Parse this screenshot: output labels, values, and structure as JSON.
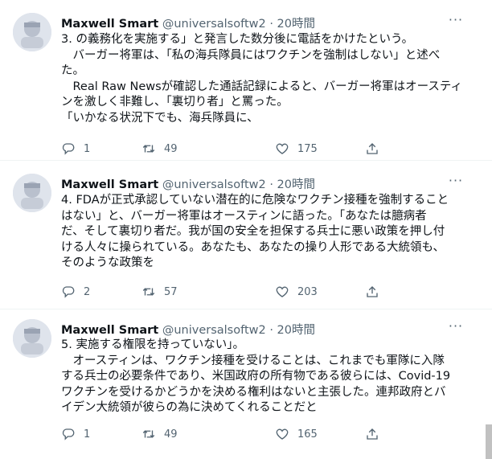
{
  "tweets": [
    {
      "name": "Maxwell Smart",
      "handle": "@universalsoftw2",
      "dot": "·",
      "time": "20時間",
      "lines": [
        "3. の義務化を実施する」と発言した数分後に電話をかけたという。",
        "　バーガー将軍は、「私の海兵隊員にはワクチンを強制はしない」と述べ",
        "た。",
        "　Real Raw Newsが確認した通話記録によると、バーガー将軍はオースティ",
        "ンを激しく非難し、「裏切り者」と罵った。",
        "「いかなる状況下でも、海兵隊員に、"
      ],
      "replies": "1",
      "retweets": "49",
      "likes": "175"
    },
    {
      "name": "Maxwell Smart",
      "handle": "@universalsoftw2",
      "dot": "·",
      "time": "20時間",
      "lines": [
        "4. FDAが正式承認していない潜在的に危険なワクチン接種を強制すること",
        "はない」と、バーガー将軍はオースティンに語った。「あなたは臆病者",
        "だ、そして裏切り者だ。我が国の安全を担保する兵士に悪い政策を押し付",
        "ける人々に操られている。あなたも、あなたの操り人形である大統領も、",
        "そのような政策を"
      ],
      "replies": "2",
      "retweets": "57",
      "likes": "203"
    },
    {
      "name": "Maxwell Smart",
      "handle": "@universalsoftw2",
      "dot": "·",
      "time": "20時間",
      "lines": [
        "5. 実施する権限を持っていない」。",
        "　オースティンは、ワクチン接種を受けることは、これまでも軍隊に入隊",
        "する兵士の必要条件であり、米国政府の所有物である彼らには、Covid-19",
        "ワクチンを受けるかどうかを決める権利はないと主張した。連邦政府とバ",
        "イデン大統領が彼らの為に決めてくれることだと"
      ],
      "replies": "1",
      "retweets": "49",
      "likes": "165"
    }
  ],
  "icons": {
    "reply": "reply-icon",
    "retweet": "retweet-icon",
    "like": "heart-icon",
    "share": "share-icon",
    "more": "more-icon"
  },
  "colors": {
    "text": "#0f1419",
    "secondary": "#536471",
    "divider": "#eff3f4"
  }
}
